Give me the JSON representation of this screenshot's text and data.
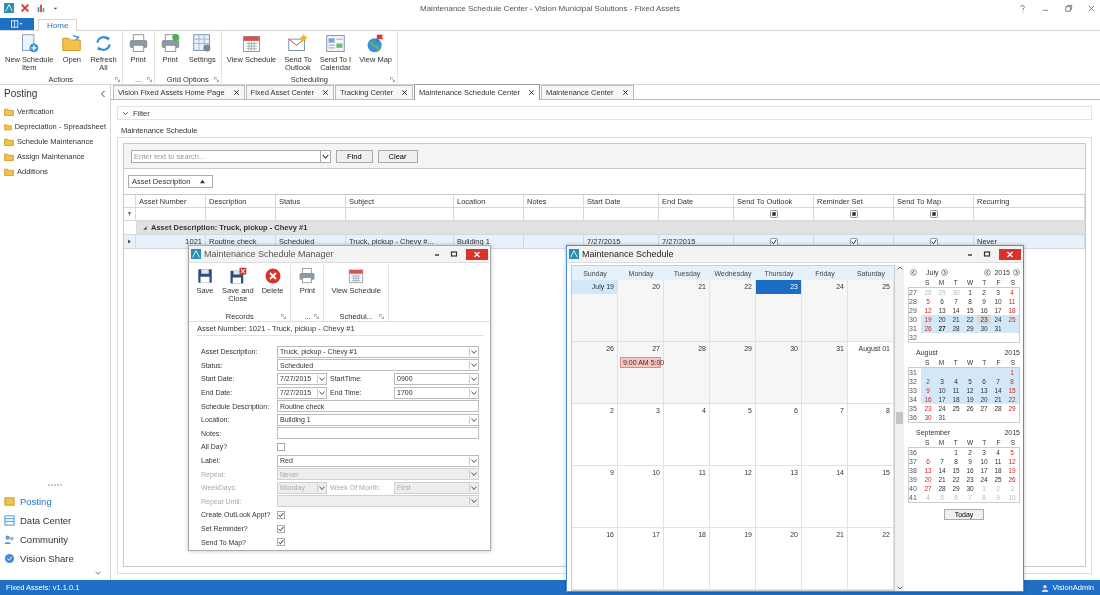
{
  "window": {
    "title": "Maintenance Schedule Center - Vision Municipal Solutions - Fixed Assets"
  },
  "ribbon": {
    "tabs": [
      {
        "label": "Home",
        "selected": true
      }
    ],
    "groups": [
      {
        "label": "Actions",
        "items": [
          {
            "label": "New Schedule\nItem"
          },
          {
            "label": "Open"
          },
          {
            "label": "Refresh\nAll"
          }
        ]
      },
      {
        "label": "...",
        "items": [
          {
            "label": "Print"
          }
        ]
      },
      {
        "label": "Grid Options",
        "items": [
          {
            "label": "Print"
          },
          {
            "label": "Settings"
          }
        ]
      },
      {
        "label": "Scheduling",
        "items": [
          {
            "label": "View Schedule"
          },
          {
            "label": "Send To\nOutlook"
          },
          {
            "label": "Send To I\nCalendar"
          },
          {
            "label": "View Map"
          }
        ]
      }
    ]
  },
  "sidebar": {
    "title": "Posting",
    "items": [
      "Verification",
      "Depreciation - Spreadsheet",
      "Schedule Maintenance",
      "Assign Maintenance",
      "Additions"
    ],
    "nav": [
      {
        "label": "Posting",
        "selected": true
      },
      {
        "label": "Data Center",
        "selected": false
      },
      {
        "label": "Community",
        "selected": false
      },
      {
        "label": "Vision Share",
        "selected": false
      }
    ]
  },
  "doc_tabs": [
    {
      "label": "Vision Fixed Assets Home Page",
      "selected": false
    },
    {
      "label": "Fixed Asset Center",
      "selected": false
    },
    {
      "label": "Tracking Center",
      "selected": false
    },
    {
      "label": "Maintenance Schedule Center",
      "selected": true
    },
    {
      "label": "Maintenance Center",
      "selected": false
    }
  ],
  "filter": {
    "label": "Filter",
    "expanded": false
  },
  "schedule": {
    "title": "Maintenance Schedule",
    "search": {
      "placeholder": "Enter text to search..."
    },
    "buttons": [
      "Find",
      "Clear"
    ],
    "group_by": {
      "label": "Asset Description"
    }
  },
  "grid": {
    "columns": [
      {
        "label": "Asset Number",
        "kind": "number"
      },
      {
        "label": "Description",
        "kind": "text"
      },
      {
        "label": "Status",
        "kind": "text"
      },
      {
        "label": "Subject",
        "kind": "text"
      },
      {
        "label": "Location",
        "kind": "text"
      },
      {
        "label": "Notes",
        "kind": "text"
      },
      {
        "label": "Start Date",
        "kind": "text"
      },
      {
        "label": "End Date",
        "kind": "text"
      },
      {
        "label": "Send To Outlook",
        "kind": "check",
        "filter_indeterminate": true
      },
      {
        "label": "Reminder Set",
        "kind": "check",
        "filter_indeterminate": true
      },
      {
        "label": "Send To Map",
        "kind": "check",
        "filter_indeterminate": true
      },
      {
        "label": "Recurring",
        "kind": "text"
      }
    ],
    "groups": [
      {
        "label": "Asset Description: Truck, pickup - Chevy #1",
        "expanded": true,
        "rows": [
          {
            "selected": true,
            "cells": [
              "1021",
              "Routine check",
              "Scheduled",
              "Truck, pickup - Chevy #...",
              "Building 1",
              null,
              "7/27/2015",
              "7/27/2015",
              true,
              true,
              true,
              "Never"
            ]
          }
        ]
      }
    ]
  },
  "manager": {
    "title": "Maintenance Schedule Manager",
    "toolbar": [
      {
        "label": "Records",
        "items": [
          {
            "label": "Save"
          },
          {
            "label": "Save and\nClose"
          },
          {
            "label": "Delete"
          }
        ]
      },
      {
        "label": "...",
        "items": [
          {
            "label": "Print"
          }
        ]
      },
      {
        "label": "Schedul...",
        "items": [
          {
            "label": "View Schedule"
          }
        ]
      }
    ],
    "legend": "Asset Number: 1021  -  Truck, pickup - Chevy #1",
    "fields": [
      {
        "kind": "combo",
        "label": "Asset Description:",
        "value": "Truck, pickup - Chevy #1",
        "disabled": false
      },
      {
        "kind": "combo",
        "label": "Status:",
        "value": "Scheduled",
        "disabled": false
      },
      {
        "kind": "pair",
        "label": "Start Date:",
        "value": "7/27/2015",
        "second_label": "StartTime:",
        "second_value": "0900",
        "disabled": false
      },
      {
        "kind": "pair",
        "label": "End Date:",
        "value": "7/27/2015",
        "second_label": "End Time:",
        "second_value": "1700",
        "disabled": false
      },
      {
        "kind": "text",
        "label": "Schedule Description:",
        "value": "Routine check",
        "disabled": false
      },
      {
        "kind": "combo",
        "label": "Location:",
        "value": "Building 1",
        "disabled": false
      },
      {
        "kind": "text",
        "label": "Notes:",
        "disabled": false
      },
      {
        "kind": "check",
        "label": "All Day?",
        "checked": false,
        "disabled": false
      },
      {
        "kind": "combo",
        "label": "Label:",
        "value": "Red",
        "disabled": false
      },
      {
        "kind": "combo",
        "label": "Repeat:",
        "value": "Never",
        "disabled": true
      },
      {
        "kind": "pair",
        "label": "WeekDays:",
        "value": "Monday",
        "second_label": "Week Of Month:",
        "second_value": "First",
        "disabled": true
      },
      {
        "kind": "combo",
        "label": "Repeat Until:",
        "disabled": true
      },
      {
        "kind": "check",
        "label": "Create OutLook Appt?",
        "checked": true,
        "disabled": false
      },
      {
        "kind": "check",
        "label": "Set Reminder?",
        "checked": true,
        "disabled": false
      },
      {
        "kind": "check",
        "label": "Send To Map?",
        "checked": true,
        "disabled": false
      }
    ]
  },
  "calendar": {
    "title": "Maintenance Schedule",
    "weekdays": [
      "Sunday",
      "Monday",
      "Tuesday",
      "Wednesday",
      "Thursday",
      "Friday",
      "Saturday"
    ],
    "weeks": [
      [
        {
          "label": "July 19",
          "kind": "start"
        },
        {
          "label": "20",
          "kind": "month"
        },
        {
          "label": "21",
          "kind": "month"
        },
        {
          "label": "22",
          "kind": "month"
        },
        {
          "label": "23",
          "kind": "today"
        },
        {
          "label": "24",
          "kind": "month"
        },
        {
          "label": "25",
          "kind": "month"
        }
      ],
      [
        {
          "label": "26",
          "kind": "month"
        },
        {
          "label": "27",
          "kind": "month",
          "appointments": [
            {
              "text": "9:00 AM  5:00",
              "color": "#f9c3c0"
            }
          ]
        },
        {
          "label": "28",
          "kind": "month"
        },
        {
          "label": "29",
          "kind": "month"
        },
        {
          "label": "30",
          "kind": "month"
        },
        {
          "label": "31",
          "kind": "month"
        },
        {
          "label": "August 01",
          "kind": "next"
        }
      ],
      [
        {
          "label": "2",
          "kind": "next"
        },
        {
          "label": "3",
          "kind": "next"
        },
        {
          "label": "4",
          "kind": "next"
        },
        {
          "label": "5",
          "kind": "next"
        },
        {
          "label": "6",
          "kind": "next"
        },
        {
          "label": "7",
          "kind": "next"
        },
        {
          "label": "8",
          "kind": "next"
        }
      ],
      [
        {
          "label": "9",
          "kind": "next"
        },
        {
          "label": "10",
          "kind": "next"
        },
        {
          "label": "11",
          "kind": "next"
        },
        {
          "label": "12",
          "kind": "next"
        },
        {
          "label": "13",
          "kind": "next"
        },
        {
          "label": "14",
          "kind": "next"
        },
        {
          "label": "15",
          "kind": "next"
        }
      ],
      [
        {
          "label": "16",
          "kind": "next"
        },
        {
          "label": "17",
          "kind": "next"
        },
        {
          "label": "18",
          "kind": "next"
        },
        {
          "label": "19",
          "kind": "next"
        },
        {
          "label": "20",
          "kind": "next"
        },
        {
          "label": "21",
          "kind": "next"
        },
        {
          "label": "22",
          "kind": "next"
        }
      ]
    ],
    "months": [
      {
        "month": "July",
        "year": "2015",
        "header": [
          "S",
          "M",
          "T",
          "W",
          "T",
          "F",
          "S"
        ],
        "weeks": [
          {
            "week": "27",
            "selected": false,
            "days": [
              {
                "label": "28",
                "kind": "muted"
              },
              {
                "label": "29",
                "kind": "muted"
              },
              {
                "label": "30",
                "kind": "muted"
              },
              {
                "label": "1",
                "kind": "day"
              },
              {
                "label": "2",
                "kind": "day"
              },
              {
                "label": "3",
                "kind": "day"
              },
              {
                "label": "4",
                "kind": "day"
              }
            ]
          },
          {
            "week": "28",
            "selected": false,
            "days": [
              {
                "label": "5",
                "kind": "day"
              },
              {
                "label": "6",
                "kind": "day"
              },
              {
                "label": "7",
                "kind": "day"
              },
              {
                "label": "8",
                "kind": "day"
              },
              {
                "label": "9",
                "kind": "day"
              },
              {
                "label": "10",
                "kind": "day"
              },
              {
                "label": "11",
                "kind": "day"
              }
            ]
          },
          {
            "week": "29",
            "selected": false,
            "days": [
              {
                "label": "12",
                "kind": "day"
              },
              {
                "label": "13",
                "kind": "day"
              },
              {
                "label": "14",
                "kind": "day"
              },
              {
                "label": "15",
                "kind": "day"
              },
              {
                "label": "16",
                "kind": "day"
              },
              {
                "label": "17",
                "kind": "day"
              },
              {
                "label": "18",
                "kind": "day"
              }
            ]
          },
          {
            "week": "30",
            "selected": true,
            "days": [
              {
                "label": "19",
                "kind": "day"
              },
              {
                "label": "20",
                "kind": "day"
              },
              {
                "label": "21",
                "kind": "day"
              },
              {
                "label": "22",
                "kind": "day"
              },
              {
                "label": "23",
                "kind": "focus"
              },
              {
                "label": "24",
                "kind": "day"
              },
              {
                "label": "25",
                "kind": "day"
              }
            ]
          },
          {
            "week": "31",
            "selected": true,
            "days": [
              {
                "label": "26",
                "kind": "day"
              },
              {
                "label": "27",
                "kind": "today"
              },
              {
                "label": "28",
                "kind": "day"
              },
              {
                "label": "29",
                "kind": "day"
              },
              {
                "label": "30",
                "kind": "day"
              },
              {
                "label": "31",
                "kind": "day"
              }
            ]
          },
          {
            "week": "32",
            "selected": false
          }
        ]
      },
      {
        "month": "August",
        "year": "2015",
        "header": [
          "S",
          "M",
          "T",
          "W",
          "T",
          "F",
          "S"
        ],
        "weeks": [
          {
            "week": "31",
            "selected": true,
            "days": [
              {
                "label": "1",
                "kind": "day"
              }
            ]
          },
          {
            "week": "32",
            "selected": true,
            "days": [
              {
                "label": "2",
                "kind": "day"
              },
              {
                "label": "3",
                "kind": "day"
              },
              {
                "label": "4",
                "kind": "day"
              },
              {
                "label": "5",
                "kind": "day"
              },
              {
                "label": "6",
                "kind": "day"
              },
              {
                "label": "7",
                "kind": "day"
              },
              {
                "label": "8",
                "kind": "day"
              }
            ]
          },
          {
            "week": "33",
            "selected": true,
            "days": [
              {
                "label": "9",
                "kind": "day"
              },
              {
                "label": "10",
                "kind": "day"
              },
              {
                "label": "11",
                "kind": "day"
              },
              {
                "label": "12",
                "kind": "day"
              },
              {
                "label": "13",
                "kind": "day"
              },
              {
                "label": "14",
                "kind": "day"
              },
              {
                "label": "15",
                "kind": "day"
              }
            ]
          },
          {
            "week": "34",
            "selected": true,
            "days": [
              {
                "label": "16",
                "kind": "day"
              },
              {
                "label": "17",
                "kind": "day"
              },
              {
                "label": "18",
                "kind": "day"
              },
              {
                "label": "19",
                "kind": "day"
              },
              {
                "label": "20",
                "kind": "day"
              },
              {
                "label": "21",
                "kind": "day"
              },
              {
                "label": "22",
                "kind": "day"
              }
            ]
          },
          {
            "week": "35",
            "selected": false,
            "days": [
              {
                "label": "23",
                "kind": "day"
              },
              {
                "label": "24",
                "kind": "day"
              },
              {
                "label": "25",
                "kind": "day"
              },
              {
                "label": "26",
                "kind": "day"
              },
              {
                "label": "27",
                "kind": "day"
              },
              {
                "label": "28",
                "kind": "day"
              },
              {
                "label": "29",
                "kind": "day"
              }
            ]
          },
          {
            "week": "36",
            "selected": false,
            "days": [
              {
                "label": "30",
                "kind": "day"
              },
              {
                "label": "31",
                "kind": "day"
              }
            ]
          }
        ]
      },
      {
        "month": "September",
        "year": "2015",
        "header": [
          "S",
          "M",
          "T",
          "W",
          "T",
          "F",
          "S"
        ],
        "weeks": [
          {
            "week": "36",
            "selected": false,
            "days": [
              {
                "label": "1",
                "kind": "day"
              },
              {
                "label": "2",
                "kind": "day"
              },
              {
                "label": "3",
                "kind": "day"
              },
              {
                "label": "4",
                "kind": "day"
              },
              {
                "label": "5",
                "kind": "day"
              }
            ]
          },
          {
            "week": "37",
            "selected": false,
            "days": [
              {
                "label": "6",
                "kind": "day"
              },
              {
                "label": "7",
                "kind": "day"
              },
              {
                "label": "8",
                "kind": "day"
              },
              {
                "label": "9",
                "kind": "day"
              },
              {
                "label": "10",
                "kind": "day"
              },
              {
                "label": "11",
                "kind": "day"
              },
              {
                "label": "12",
                "kind": "day"
              }
            ]
          },
          {
            "week": "38",
            "selected": false,
            "days": [
              {
                "label": "13",
                "kind": "day"
              },
              {
                "label": "14",
                "kind": "day"
              },
              {
                "label": "15",
                "kind": "day"
              },
              {
                "label": "16",
                "kind": "day"
              },
              {
                "label": "17",
                "kind": "day"
              },
              {
                "label": "18",
                "kind": "day"
              },
              {
                "label": "19",
                "kind": "day"
              }
            ]
          },
          {
            "week": "39",
            "selected": false,
            "days": [
              {
                "label": "20",
                "kind": "day"
              },
              {
                "label": "21",
                "kind": "day"
              },
              {
                "label": "22",
                "kind": "day"
              },
              {
                "label": "23",
                "kind": "day"
              },
              {
                "label": "24",
                "kind": "day"
              },
              {
                "label": "25",
                "kind": "day"
              },
              {
                "label": "26",
                "kind": "day"
              }
            ]
          },
          {
            "week": "40",
            "selected": false,
            "days": [
              {
                "label": "27",
                "kind": "day"
              },
              {
                "label": "28",
                "kind": "day"
              },
              {
                "label": "29",
                "kind": "day"
              },
              {
                "label": "30",
                "kind": "day"
              },
              {
                "label": "1",
                "kind": "muted"
              },
              {
                "label": "2",
                "kind": "muted"
              },
              {
                "label": "3",
                "kind": "muted"
              }
            ]
          },
          {
            "week": "41",
            "selected": false,
            "days": [
              {
                "label": "4",
                "kind": "muted"
              },
              {
                "label": "5",
                "kind": "muted"
              },
              {
                "label": "6",
                "kind": "muted"
              },
              {
                "label": "7",
                "kind": "muted"
              },
              {
                "label": "8",
                "kind": "muted"
              },
              {
                "label": "9",
                "kind": "muted"
              },
              {
                "label": "10",
                "kind": "muted"
              }
            ]
          }
        ]
      }
    ],
    "today_button": "Today"
  },
  "status_bar": {
    "text": "Fixed Assets: v1.1.0.1",
    "user": "VisionAdmin"
  }
}
